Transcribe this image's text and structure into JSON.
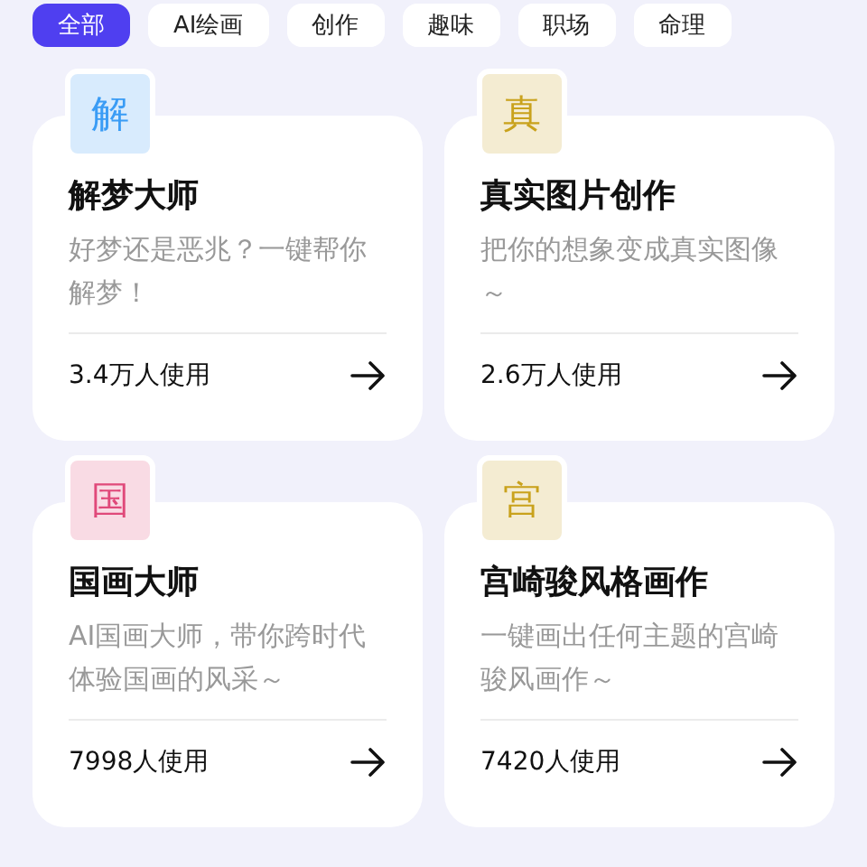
{
  "tabs": [
    {
      "label": "全部",
      "selected": true
    },
    {
      "label": "AI绘画",
      "selected": false
    },
    {
      "label": "创作",
      "selected": false
    },
    {
      "label": "趣味",
      "selected": false
    },
    {
      "label": "职场",
      "selected": false
    },
    {
      "label": "命理",
      "selected": false
    }
  ],
  "cards": [
    {
      "badge": "解",
      "color": "#3a9cf5",
      "title": "解梦大师",
      "description": "好梦还是恶兆？一键帮你解梦！",
      "usage": "3.4万人使用"
    },
    {
      "badge": "真",
      "color": "#c9a21c",
      "title": "真实图片创作",
      "description": "把你的想象变成真实图像～",
      "usage": "2.6万人使用"
    },
    {
      "badge": "国",
      "color": "#e0497a",
      "title": "国画大师",
      "description": "AI国画大师，带你跨时代体验国画的风采～",
      "usage": "7998人使用"
    },
    {
      "badge": "宫",
      "color": "#c9a21c",
      "title": "宫崎骏风格画作",
      "description": "一键画出任何主题的宫崎骏风画作～",
      "usage": "7420人使用"
    }
  ]
}
